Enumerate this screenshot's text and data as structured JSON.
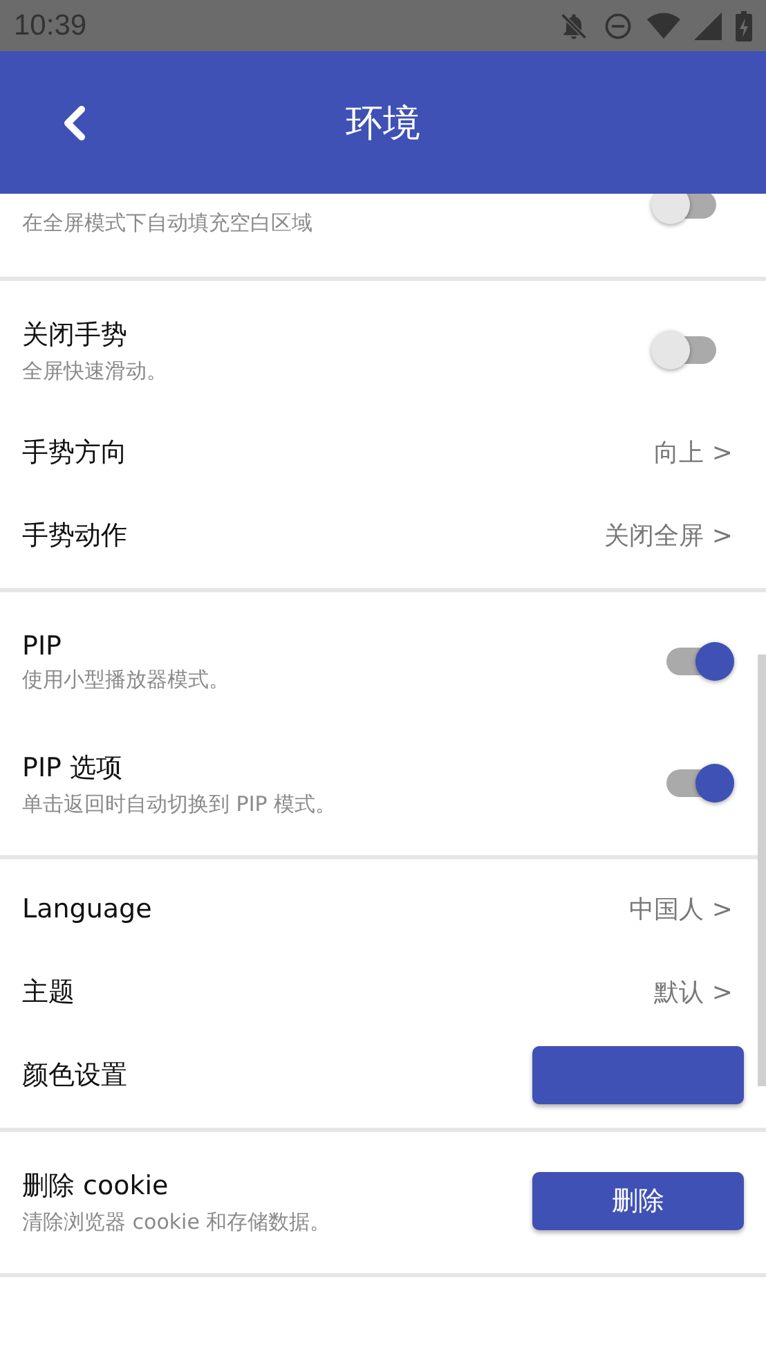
{
  "status_bar": {
    "time": "10:39"
  },
  "app_bar": {
    "title": "环境"
  },
  "sections": [
    {
      "items": [
        {
          "kind": "toggle",
          "subtitle": "在全屏模式下自动填充空白区域",
          "on": false
        }
      ]
    },
    {
      "items": [
        {
          "kind": "toggle",
          "title": "关闭手势",
          "subtitle": "全屏快速滑动。",
          "on": false
        },
        {
          "kind": "link",
          "title": "手势方向",
          "value": "向上 >"
        },
        {
          "kind": "link",
          "title": "手势动作",
          "value": "关闭全屏 >"
        }
      ]
    },
    {
      "items": [
        {
          "kind": "toggle",
          "title": "PIP",
          "subtitle": "使用小型播放器模式。",
          "on": true
        },
        {
          "kind": "toggle",
          "title": "PIP 选项",
          "subtitle": "单击返回时自动切换到 PIP 模式。",
          "on": true
        }
      ]
    },
    {
      "items": [
        {
          "kind": "link",
          "title": "Language",
          "value": "中国人 >"
        },
        {
          "kind": "link",
          "title": "主题",
          "value": "默认 >"
        },
        {
          "kind": "color",
          "title": "颜色设置",
          "color": "#3f51b5"
        }
      ]
    },
    {
      "items": [
        {
          "kind": "button",
          "title": "删除 cookie",
          "subtitle": "清除浏览器 cookie 和存储数据。",
          "button": "删除"
        }
      ]
    }
  ]
}
